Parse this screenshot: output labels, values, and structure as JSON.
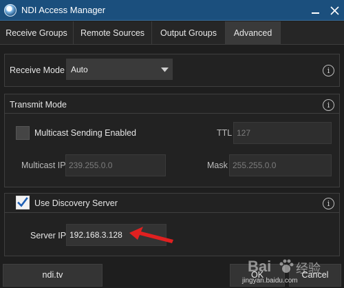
{
  "window": {
    "title": "NDI Access Manager"
  },
  "tabs": [
    {
      "label": "Receive Groups",
      "active": false
    },
    {
      "label": "Remote Sources",
      "active": false
    },
    {
      "label": "Output Groups",
      "active": false
    },
    {
      "label": "Advanced",
      "active": true
    }
  ],
  "receive_mode": {
    "label": "Receive Mode",
    "value": "Auto"
  },
  "transmit_mode": {
    "title": "Transmit Mode",
    "multicast_checkbox_label": "Multicast Sending Enabled",
    "multicast_checked": false,
    "ttl_label": "TTL",
    "ttl_value": "127",
    "multicast_ip_label": "Multicast IP",
    "multicast_ip_value": "239.255.0.0",
    "mask_label": "Mask",
    "mask_value": "255.255.0.0"
  },
  "discovery": {
    "checkbox_label": "Use Discovery Server",
    "checked": true,
    "server_ip_label": "Server IP",
    "server_ip_value": "192.168.3.128"
  },
  "buttons": {
    "ndi_tv": "ndi.tv",
    "ok": "OK",
    "cancel": "Cancel"
  },
  "info_glyph": "i",
  "watermark": {
    "brand": "Bai",
    "brand_cn": "经验",
    "site": "jingyan.baidu.com"
  },
  "icons": {
    "app": "ndi-app-icon",
    "minimize": "minimize-icon",
    "close": "close-icon",
    "dropdown": "caret-down-icon",
    "info": "info-icon",
    "check": "check-icon",
    "arrow": "red-arrow-annotation",
    "watermark_paw": "baidu-paw-icon"
  },
  "colors": {
    "titlebar": "#1b4f7d",
    "annotation_arrow": "#e02020",
    "check": "#1e5fb4"
  }
}
